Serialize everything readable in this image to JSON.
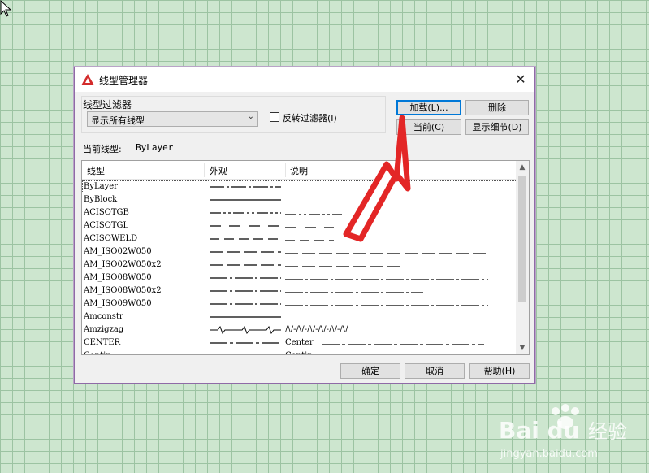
{
  "dialog": {
    "title": "线型管理器",
    "close": "✕",
    "filter_group_label": "线型过滤器",
    "filter_value": "显示所有线型",
    "invert_label": "反转过滤器(I)",
    "buttons": {
      "load": "加载(L)...",
      "delete": "删除",
      "current": "当前(C)",
      "details": "显示细节(D)",
      "ok": "确定",
      "cancel": "取消",
      "help": "帮助(H)"
    },
    "current_linetype_label": "当前线型:",
    "current_linetype_value": "ByLayer",
    "columns": {
      "name": "线型",
      "appearance": "外观",
      "description": "说明"
    },
    "rows": [
      {
        "name": "ByLayer",
        "desc": "",
        "pattern": "dash-dot"
      },
      {
        "name": "ByBlock",
        "desc": "",
        "pattern": "solid"
      },
      {
        "name": "ACISOTGB",
        "desc": "",
        "pattern": "dash-dot-dot"
      },
      {
        "name": "ACISOTGL",
        "desc": "",
        "pattern": "long-gap"
      },
      {
        "name": "ACISOWELD",
        "desc": "",
        "pattern": "dash-gap"
      },
      {
        "name": "AM_ISO02W050",
        "desc": "",
        "pattern": "dashes"
      },
      {
        "name": "AM_ISO02W050x2",
        "desc": "",
        "pattern": "dashes"
      },
      {
        "name": "AM_ISO08W050",
        "desc": "",
        "pattern": "long-dash-dot"
      },
      {
        "name": "AM_ISO08W050x2",
        "desc": "",
        "pattern": "long-dash-dot"
      },
      {
        "name": "AM_ISO09W050",
        "desc": "",
        "pattern": "long-dash-dot"
      },
      {
        "name": "Amconstr",
        "desc": "",
        "pattern": "solid"
      },
      {
        "name": "Amzigzag",
        "desc": "/\\/-/\\/-/\\/-/\\/-/\\/-/\\/",
        "pattern": "zigzag"
      },
      {
        "name": "CENTER",
        "desc": "Center",
        "pattern": "center"
      },
      {
        "name": "Contin",
        "desc": "Contin",
        "pattern": "solid"
      }
    ]
  },
  "colors": {
    "accent": "#0078d7",
    "arrow": "#e32626",
    "grid": "#9cc3a2",
    "canvas": "#cde6cf"
  },
  "icons": [
    "autocad-logo-icon",
    "close-icon",
    "chevron-down-icon",
    "scroll-up-icon",
    "scroll-down-icon",
    "cursor-icon",
    "arrow-annotation-icon",
    "watermark-paw-icon"
  ],
  "watermark": {
    "brand": "Bai du",
    "cn": "经验",
    "url": "jingyan.baidu.com"
  }
}
